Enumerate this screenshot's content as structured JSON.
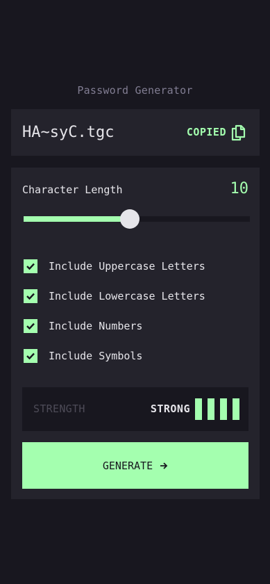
{
  "app": {
    "title": "Password Generator"
  },
  "output": {
    "password": "HA~syC.tgc",
    "copied_label": "COPIED",
    "copy_icon": "copy-icon"
  },
  "length": {
    "label": "Character Length",
    "value": "10",
    "slider_fraction": 0.47
  },
  "options": [
    {
      "label": "Include Uppercase Letters",
      "checked": true
    },
    {
      "label": "Include Lowercase Letters",
      "checked": true
    },
    {
      "label": "Include Numbers",
      "checked": true
    },
    {
      "label": "Include Symbols",
      "checked": true
    }
  ],
  "strength": {
    "label": "STRENGTH",
    "value": "STRONG",
    "bars_filled": 4,
    "bars_total": 4
  },
  "generate": {
    "label": "GENERATE",
    "icon": "arrow-right-icon"
  },
  "colors": {
    "accent": "#a4ffaf",
    "background": "#18171f",
    "panel": "#24232c",
    "text": "#e6e5ea",
    "muted": "#817d92"
  }
}
